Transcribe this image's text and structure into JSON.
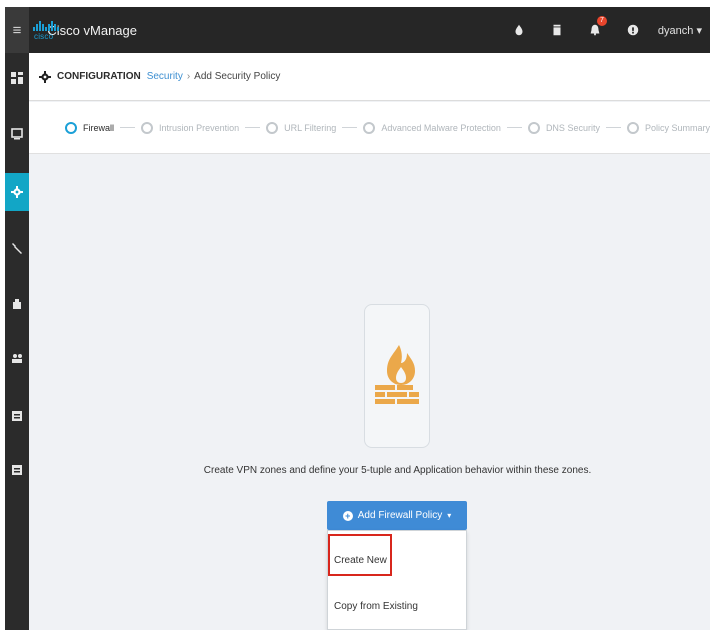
{
  "app": {
    "title": "Cisco vManage",
    "logo_text": "cisco",
    "user": "dyanch"
  },
  "topbar": {
    "icons": [
      "cloud-icon",
      "trash-icon",
      "bell-icon",
      "help-icon"
    ],
    "notification_count": "7",
    "user_caret": "▾"
  },
  "leftnav": {
    "items": [
      "dashboard-icon",
      "monitor-icon",
      "configuration-gear-icon",
      "tools-wrench-icon",
      "maintenance-icon",
      "administration-users-icon",
      "vanalytics-icon",
      "vanalytics-2-icon"
    ],
    "active": "configuration-gear-icon"
  },
  "breadcrumb": {
    "title": "CONFIGURATION",
    "link": "Security",
    "separator": "›",
    "current": "Add Security Policy"
  },
  "steps": [
    {
      "label": "Firewall",
      "active": true
    },
    {
      "label": "Intrusion Prevention",
      "active": false
    },
    {
      "label": "URL Filtering",
      "active": false
    },
    {
      "label": "Advanced Malware Protection",
      "active": false
    },
    {
      "label": "DNS Security",
      "active": false
    },
    {
      "label": "Policy Summary",
      "active": false
    }
  ],
  "main": {
    "description": "Create VPN zones and define your 5-tuple and Application behavior within these zones.",
    "add_button": "Add Firewall Policy",
    "add_button_caret": "▾",
    "dropdown": {
      "create_new": "Create New",
      "copy_existing": "Copy from Existing"
    }
  },
  "colors": {
    "accent": "#12a6c6",
    "button": "#3f8bd6",
    "highlight": "#d8261c",
    "firewall_icon": "#eba84a"
  }
}
